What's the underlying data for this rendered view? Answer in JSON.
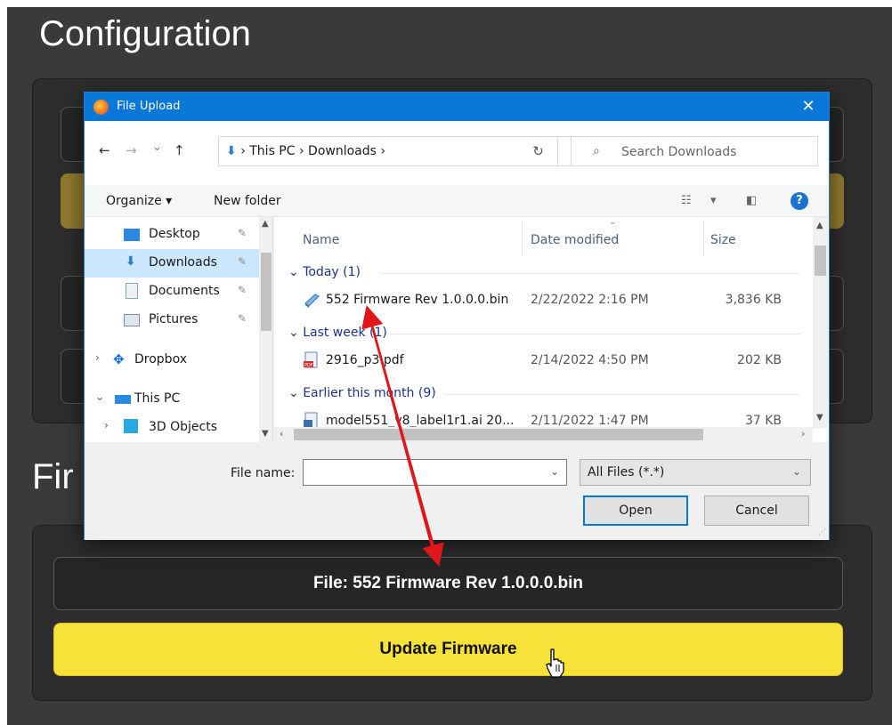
{
  "page": {
    "title": "Configuration",
    "section_title": "Fir",
    "file_label": "File: 552 Firmware Rev 1.0.0.0.bin",
    "update_button": "Update Firmware",
    "colors": {
      "background": "#3a3a3a",
      "panel": "#2d2d2d",
      "update_button": "#f7e23a"
    }
  },
  "dialog": {
    "title": "File Upload",
    "close_glyph": "✕",
    "nav": {
      "back": "←",
      "forward": "→",
      "recent": "⌄",
      "up": "↑"
    },
    "breadcrumbs": [
      "This PC",
      "Downloads"
    ],
    "breadcrumb_sep": "›",
    "refresh_glyph": "↻",
    "search_placeholder": "Search Downloads",
    "toolbar": {
      "organize": "Organize ▾",
      "new_folder": "New folder",
      "view_dropdown": "▾",
      "help": "?"
    },
    "tree": [
      {
        "label": "Desktop",
        "icon": "desktop-icon",
        "pinned": true
      },
      {
        "label": "Downloads",
        "icon": "downloads-icon",
        "pinned": true,
        "selected": true
      },
      {
        "label": "Documents",
        "icon": "documents-icon",
        "pinned": true
      },
      {
        "label": "Pictures",
        "icon": "pictures-icon",
        "pinned": true
      },
      {
        "label": "Dropbox",
        "icon": "dropbox-icon",
        "expander": "›"
      },
      {
        "label": "This PC",
        "icon": "this-pc-icon",
        "expander": "⌄"
      },
      {
        "label": "3D Objects",
        "icon": "3d-objects-icon",
        "expander": "›"
      }
    ],
    "columns": {
      "name": "Name",
      "date": "Date modified",
      "size": "Size"
    },
    "groups": [
      {
        "label": "Today (1)",
        "files": [
          {
            "name": "552 Firmware Rev 1.0.0.0.bin",
            "date": "2/22/2022 2:16 PM",
            "size": "3,836 KB",
            "icon": "bin-file-icon"
          }
        ]
      },
      {
        "label": "Last week (1)",
        "files": [
          {
            "name": "2916_p3.pdf",
            "date": "2/14/2022 4:50 PM",
            "size": "202 KB",
            "icon": "pdf-file-icon"
          }
        ]
      },
      {
        "label": "Earlier this month (9)",
        "files": [
          {
            "name": "model551_v8_label1r1.ai 20...",
            "date": "2/11/2022 1:47 PM",
            "size": "37 KB",
            "icon": "ai-file-icon"
          }
        ]
      }
    ],
    "file_name_label": "File name:",
    "file_name_value": "",
    "file_type": "All Files (*.*)",
    "open_button": "Open",
    "cancel_button": "Cancel",
    "colors": {
      "titlebar": "#0a78d7",
      "selection": "#cce8ff",
      "group_text": "#1e3287"
    }
  }
}
